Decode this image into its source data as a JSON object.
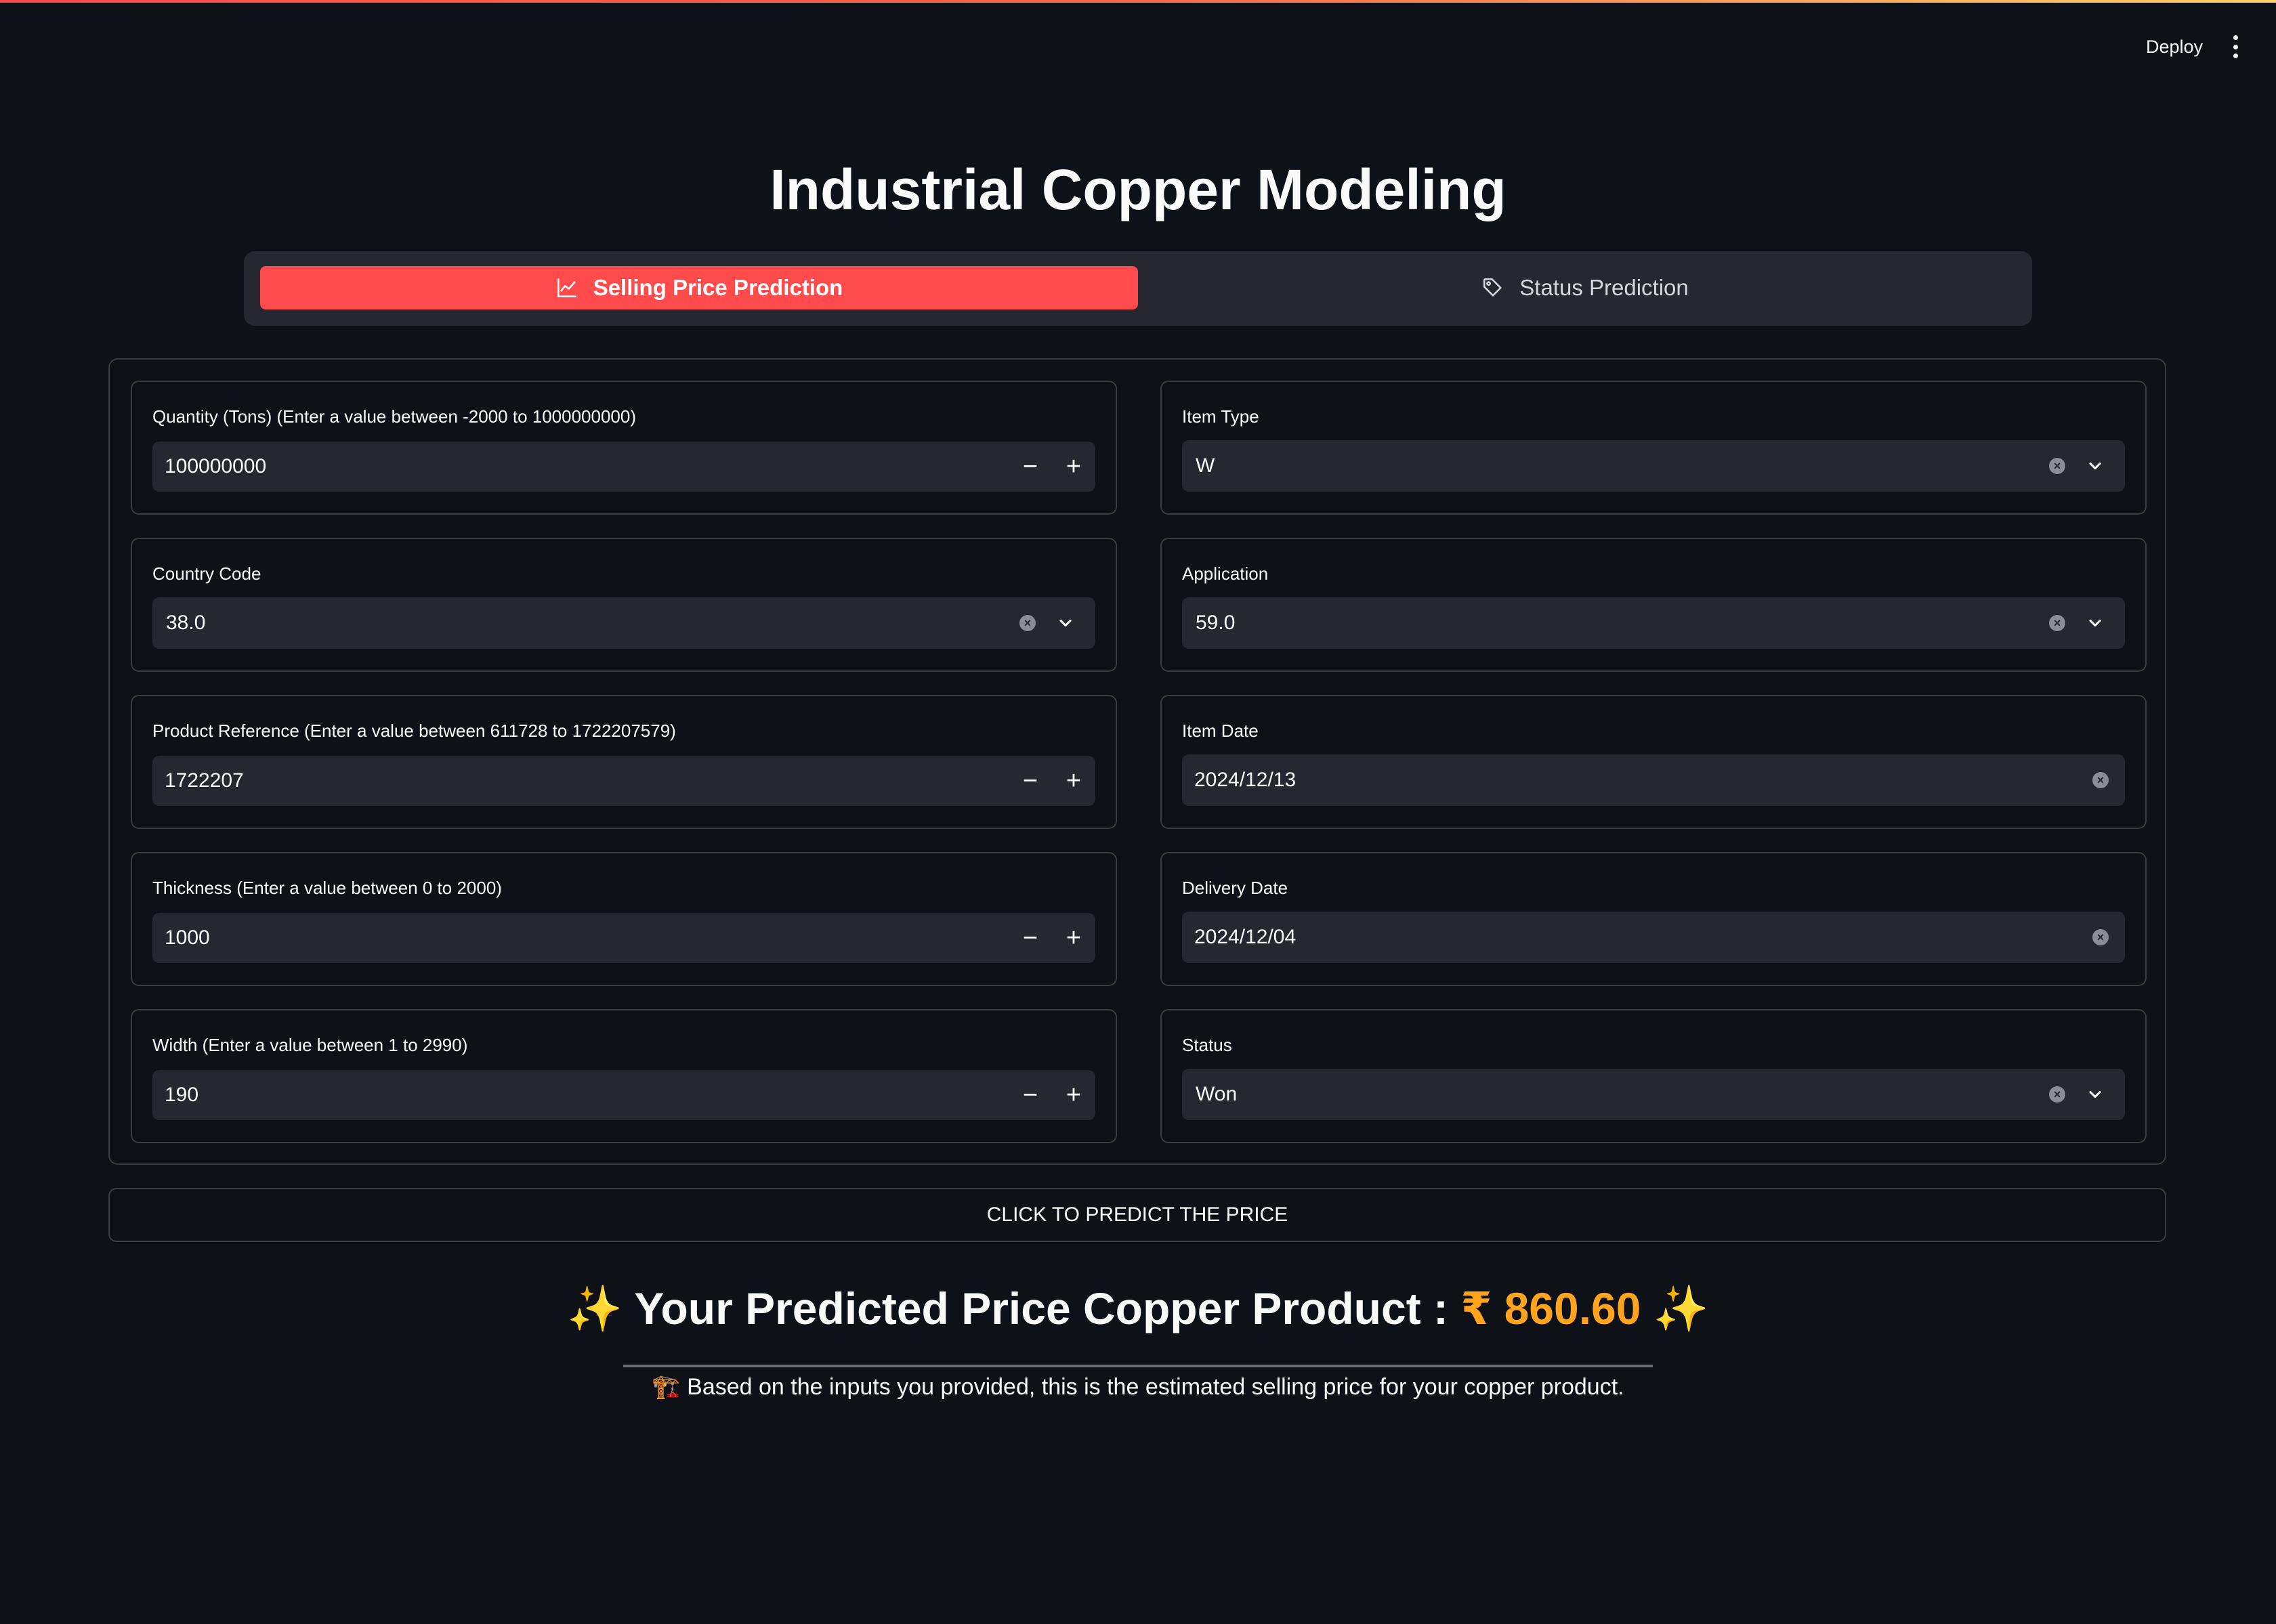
{
  "header": {
    "deploy_label": "Deploy",
    "menu_icon": "more-vertical-icon"
  },
  "title": "Industrial Copper Modeling",
  "tabs": [
    {
      "label": "Selling Price Prediction",
      "icon": "line-chart-icon",
      "active": true
    },
    {
      "label": "Status Prediction",
      "icon": "tag-icon",
      "active": false
    }
  ],
  "left_fields": [
    {
      "label": "Quantity (Tons) (Enter a value between -2000 to 1000000000)",
      "value": "100000000"
    },
    {
      "label": "Country Code",
      "value": "38.0"
    },
    {
      "label": "Product Reference (Enter a value between 611728 to 1722207579)",
      "value": "1722207"
    },
    {
      "label": "Thickness (Enter a value between 0 to 2000)",
      "value": "1000"
    },
    {
      "label": "Width (Enter a value between 1 to 2990)",
      "value": "190"
    }
  ],
  "right_fields": [
    {
      "label": "Item Type",
      "value": "W"
    },
    {
      "label": "Application",
      "value": "59.0"
    },
    {
      "label": "Item Date",
      "value": "2024/12/13"
    },
    {
      "label": "Delivery Date",
      "value": "2024/12/04"
    },
    {
      "label": "Status",
      "value": "Won"
    }
  ],
  "stepper": {
    "minus": "−",
    "plus": "+"
  },
  "predict_button": "CLICK TO PREDICT THE PRICE",
  "result": {
    "sparkle": "✨",
    "text": "Your Predicted Price Copper Product :",
    "price": "₹ 860.60"
  },
  "note": {
    "icon": "🏗️",
    "text": "Based on the inputs you provided, this is the estimated selling price for your copper product."
  },
  "colors": {
    "accent": "#ff4b4b",
    "price": "#ffa41c",
    "background": "#0e1117",
    "input_bg": "#262730"
  }
}
